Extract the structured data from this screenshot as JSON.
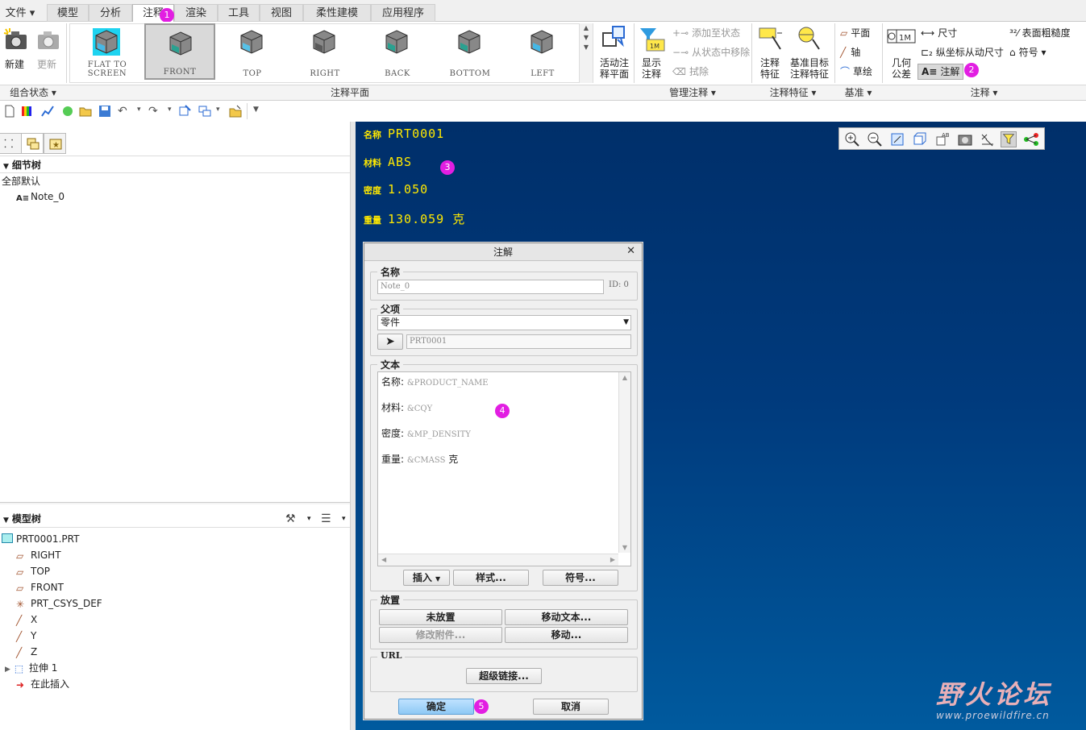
{
  "menu": {
    "file_label": "文件",
    "tabs": [
      "模型",
      "分析",
      "注释",
      "渲染",
      "工具",
      "视图",
      "柔性建模",
      "应用程序"
    ],
    "active_tab": "注释"
  },
  "ribbon": {
    "new_label": "新建",
    "update_label": "更新",
    "views": [
      "FLAT TO SCREEN",
      "FRONT",
      "TOP",
      "RIGHT",
      "BACK",
      "BOTTOM",
      "LEFT"
    ],
    "selected_view": "FRONT",
    "activate_plane": [
      "活动注",
      "释平面"
    ],
    "show_annotation": [
      "显示",
      "注释"
    ],
    "add_to_state": "添加至状态",
    "remove_from_state": "从状态中移除",
    "erase": "拭除",
    "annotation_feature": [
      "注释",
      "特征"
    ],
    "datum_target": [
      "基准目标",
      "注释特征"
    ],
    "plane": "平面",
    "axis": "轴",
    "sketch": "草绘",
    "gtol": [
      "几何",
      "公差"
    ],
    "dimension": "尺寸",
    "ordinate_dim": "纵坐标从动尺寸",
    "note": "注解",
    "surface_finish": "表面粗糙度",
    "symbol": "符号",
    "groups": [
      "组合状态",
      "注释平面",
      "管理注释",
      "注释特征",
      "基准",
      "注释"
    ]
  },
  "left_panel": {
    "detail_tree_title": "细节树",
    "detail_default": "全部默认",
    "detail_items": [
      "Note_0"
    ],
    "model_tree_title": "模型树",
    "model_items": [
      "PRT0001.PRT",
      "RIGHT",
      "TOP",
      "FRONT",
      "PRT_CSYS_DEF",
      "X",
      "Y",
      "Z",
      "拉伸 1",
      "在此插入"
    ]
  },
  "graphics": {
    "notes": [
      {
        "key": "名称",
        "value": "PRT0001"
      },
      {
        "key": "材料",
        "value": "ABS"
      },
      {
        "key": "密度",
        "value": "1.050"
      },
      {
        "key": "重量",
        "value": "130.059 克"
      }
    ],
    "watermark": {
      "cn": "野火论坛",
      "url": "www.proewildfire.cn"
    }
  },
  "dialog": {
    "title": "注解",
    "name_section": "名称",
    "name_value": "Note_0",
    "id_label": "ID: 0",
    "parent_section": "父项",
    "parent_type": "零件",
    "parent_value": "PRT0001",
    "text_section": "文本",
    "text_lines": [
      {
        "label": "名称:",
        "param": "&PRODUCT_NAME",
        "suffix": ""
      },
      {
        "label": "材料:",
        "param": "&CQY",
        "suffix": ""
      },
      {
        "label": "密度:",
        "param": "&MP_DENSITY",
        "suffix": ""
      },
      {
        "label": "重量:",
        "param": "&CMASS",
        "suffix": " 克"
      }
    ],
    "insert_btn": "插入",
    "style_btn": "样式...",
    "symbol_btn": "符号...",
    "placement_section": "放置",
    "unplaced_btn": "未放置",
    "move_text_btn": "移动文本...",
    "modify_attach_btn": "修改附件...",
    "move_btn": "移动...",
    "url_section": "URL",
    "hyperlink_btn": "超级链接...",
    "ok_btn": "确定",
    "cancel_btn": "取消"
  },
  "badges": [
    "1",
    "2",
    "3",
    "4",
    "5"
  ],
  "colors": {
    "accent_magenta": "#e21ee2",
    "note_yellow": "#ffe900",
    "bg_blue": "#003a7c"
  }
}
